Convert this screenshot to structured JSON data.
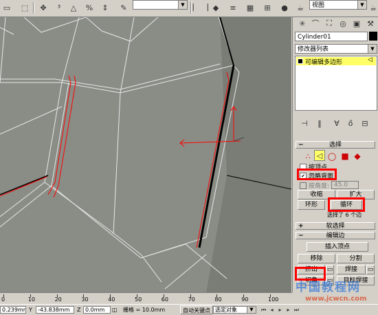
{
  "toolbar": {
    "left_dropdown": "",
    "view_dropdown": "视图"
  },
  "panel": {
    "object_name": "Cylinder01",
    "modifier_list": "修改器列表",
    "stack_item": "可编辑多边形",
    "selection_rollout": "选择",
    "by_vertex": "按顶点",
    "ignore_backfacing": "忽略背面",
    "by_angle": "按角度:",
    "angle_value": "45.0",
    "shrink": "收缩",
    "grow": "扩大",
    "ring": "环形",
    "loop": "循环",
    "selected_info": "选择了 6 个边",
    "soft_selection": "软选择",
    "edit_edges": "编辑边",
    "insert_vertex": "插入顶点",
    "remove": "移除",
    "split": "分割",
    "extrude": "挤出",
    "weld": "焊接",
    "chamfer": "切角",
    "target_weld": "目标焊接"
  },
  "timeline": {
    "ticks": [
      "0",
      "10",
      "20",
      "30",
      "40",
      "50",
      "60",
      "70",
      "80",
      "90",
      "100"
    ]
  },
  "status": {
    "x_value": "0.239mm",
    "y_label": "Y",
    "y_value": "-43.838mm",
    "z_label": "Z",
    "z_value": "0.0mm",
    "grid_label": "栅格 = 10.0mm",
    "auto_key": "自动关键点",
    "selected_object": "选定对象"
  },
  "watermark": {
    "line1": "中国教程网",
    "line2": "www.jcwcn.com"
  },
  "colors": {
    "viewport_bg": "#8a8d86",
    "selected_edge": "#ff0000",
    "highlight_box": "#ff0000",
    "stack_highlight": "#ffff66"
  }
}
